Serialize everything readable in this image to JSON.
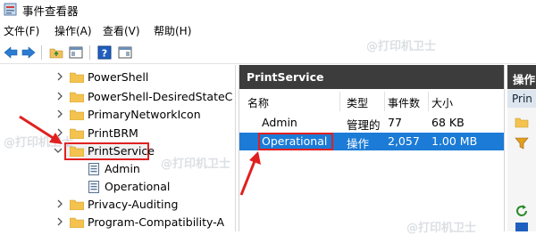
{
  "window": {
    "title": "事件查看器"
  },
  "menu": [
    {
      "label": "文件(F)"
    },
    {
      "label": "操作(A)"
    },
    {
      "label": "查看(V)"
    },
    {
      "label": "帮助(H)"
    }
  ],
  "tree": {
    "items": [
      {
        "label": "PowerShell",
        "icon": "folder-icon"
      },
      {
        "label": "PowerShell-DesiredStateC",
        "icon": "folder-icon"
      },
      {
        "label": "PrimaryNetworkIcon",
        "icon": "folder-icon"
      },
      {
        "label": "PrintBRM",
        "icon": "folder-icon"
      },
      {
        "label": "PrintService",
        "icon": "folder-icon",
        "selected": true
      },
      {
        "label": "Admin",
        "icon": "log-icon"
      },
      {
        "label": "Operational",
        "icon": "log-icon"
      },
      {
        "label": "Privacy-Auditing",
        "icon": "folder-icon"
      },
      {
        "label": "Program-Compatibility-A",
        "icon": "folder-icon"
      }
    ]
  },
  "middle": {
    "title": "PrintService",
    "columns": [
      "名称",
      "类型",
      "事件数",
      "大小"
    ],
    "rows": [
      {
        "name": "Admin",
        "type": "管理的",
        "count": "77",
        "size": "68 KB",
        "selected": false
      },
      {
        "name": "Operational",
        "type": "操作",
        "count": "2,057",
        "size": "1.00 MB",
        "selected": true
      }
    ]
  },
  "actions": {
    "title": "操作",
    "subtitle": "Prin"
  },
  "watermark": "@打印机卫士",
  "colors": {
    "selection": "#1b7bd6",
    "annotation": "#e02020",
    "header": "#3c3c3c"
  }
}
